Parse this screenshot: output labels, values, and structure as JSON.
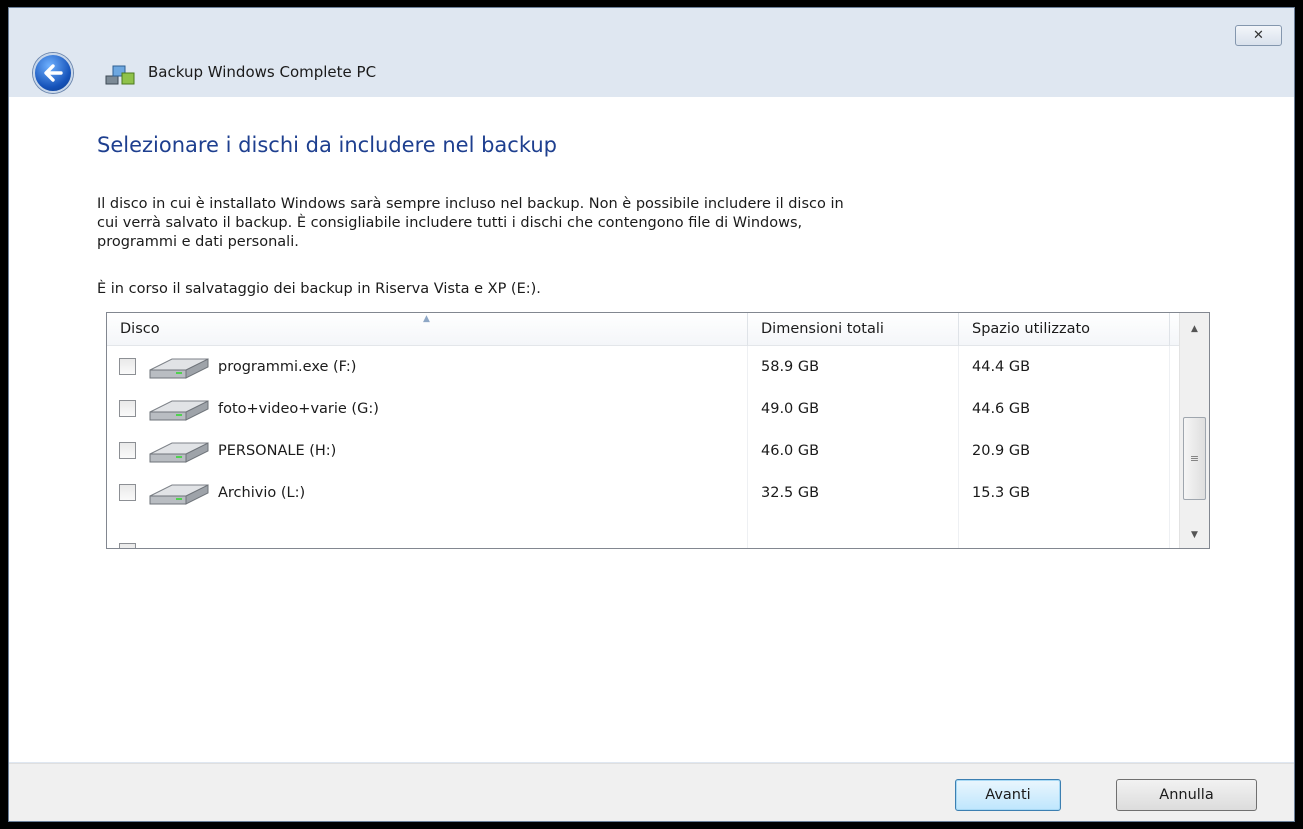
{
  "window": {
    "title": "Backup Windows Complete PC",
    "close_glyph": "✕"
  },
  "page": {
    "heading": "Selezionare i dischi da includere nel backup",
    "description_lines": [
      "Il disco in cui è installato Windows sarà sempre incluso nel backup. Non è possibile includere il disco in",
      "cui verrà salvato il backup. È consigliabile includere tutti i dischi che contengono file di Windows,",
      "programmi e dati personali."
    ],
    "status": "È in corso il salvataggio dei backup in Riserva Vista e XP (E:)."
  },
  "disk_list": {
    "columns": [
      "Disco",
      "Dimensioni totali",
      "Spazio utilizzato"
    ],
    "rows": [
      {
        "name": "programmi.exe (F:)",
        "total": "58.9 GB",
        "used": "44.4 GB",
        "checked": false
      },
      {
        "name": "foto+video+varie (G:)",
        "total": "49.0 GB",
        "used": "44.6 GB",
        "checked": false
      },
      {
        "name": "PERSONALE (H:)",
        "total": "46.0 GB",
        "used": "20.9 GB",
        "checked": false
      },
      {
        "name": "Archivio (L:)",
        "total": "32.5 GB",
        "used": "15.3 GB",
        "checked": false
      }
    ],
    "icons": {
      "disk": "hard-drive-icon",
      "sort": "sort-up-arrow-icon"
    }
  },
  "buttons": {
    "next": "Avanti",
    "cancel": "Annulla"
  },
  "colors": {
    "heading": "#1e3f8f",
    "frame": "#dfe7f1",
    "primary_button": "#bee6fd"
  }
}
